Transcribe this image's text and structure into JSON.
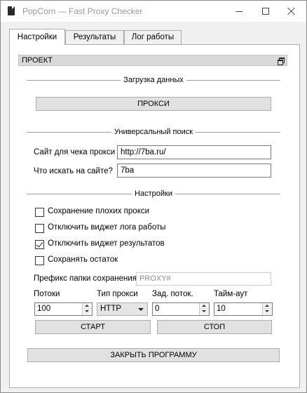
{
  "window": {
    "title": "PopCorn — Fast Proxy Checker"
  },
  "tabs": [
    {
      "label": "Настройки",
      "active": true
    },
    {
      "label": "Результаты",
      "active": false
    },
    {
      "label": "Лог работы",
      "active": false
    }
  ],
  "project": {
    "label": "ПРОЕКТ"
  },
  "data_section": {
    "title": "Загрузка данных",
    "proxy_button": "ПРОКСИ"
  },
  "search_section": {
    "title": "Универсальный поиск",
    "site_label": "Сайт для чека прокси",
    "site_value": "http://7ba.ru/",
    "find_label": "Что искать на сайте?",
    "find_value": "7ba"
  },
  "settings_section": {
    "title": "Настройки",
    "checkboxes": [
      {
        "label": "Сохранение плохих прокси",
        "checked": false
      },
      {
        "label": "Отключить виджет лога работы",
        "checked": false
      },
      {
        "label": "Отключить виджет результатов",
        "checked": true
      },
      {
        "label": "Сохранять остаток",
        "checked": false
      }
    ],
    "prefix_label": "Префикс папки сохранения",
    "prefix_placeholder": "PROXY#",
    "threads_label": "Потоки",
    "threads_value": "100",
    "proxy_type_label": "Тип прокси",
    "proxy_type_value": "HTTP",
    "thread_delay_label": "Зад. поток.",
    "thread_delay_value": "0",
    "timeout_label": "Тайм-аут",
    "timeout_value": "10"
  },
  "actions": {
    "start": "СТАРТ",
    "stop": "СТОП",
    "close_program": "ЗАКРЫТЬ ПРОГРАММУ"
  },
  "icons": {
    "app": "document-icon",
    "minimize": "minimize-icon",
    "maximize": "maximize-icon",
    "close": "close-icon",
    "restore": "restore-icon"
  }
}
